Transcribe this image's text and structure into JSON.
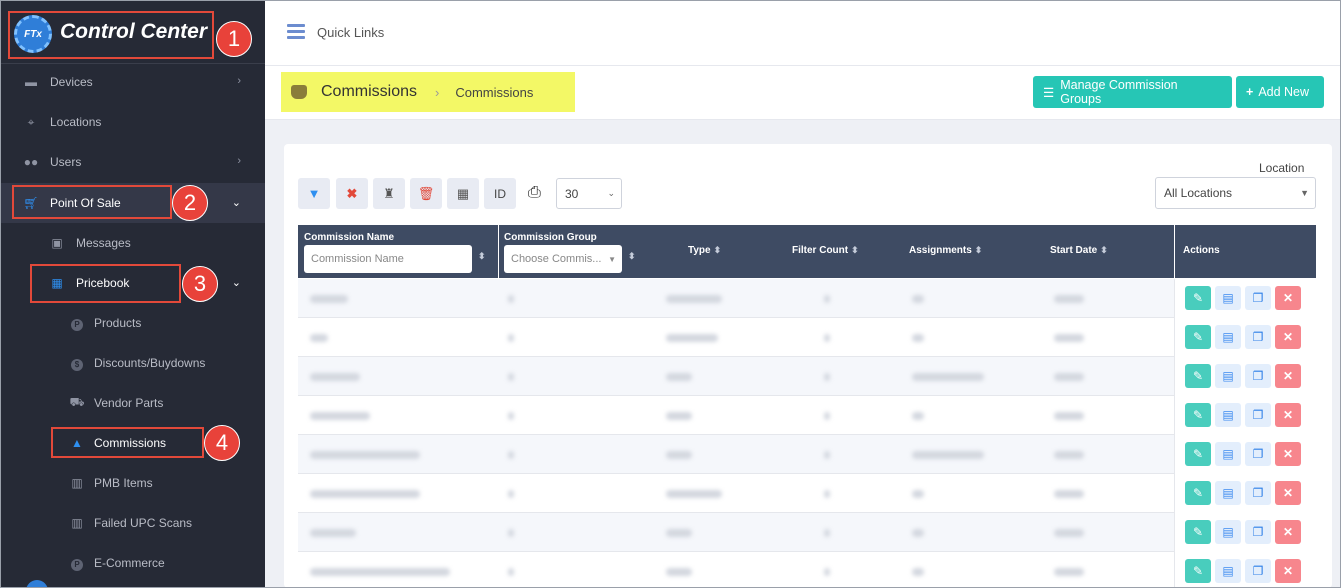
{
  "brand": {
    "logo_text": "FTx",
    "title": "Control Center"
  },
  "sidebar": {
    "items": [
      {
        "label": "Devices",
        "icon": "devices-icon"
      },
      {
        "label": "Locations",
        "icon": "map-pin-icon"
      },
      {
        "label": "Users",
        "icon": "users-icon"
      },
      {
        "label": "Point Of Sale",
        "icon": "cart-icon"
      },
      {
        "label": "Messages",
        "icon": "messages-icon"
      },
      {
        "label": "Pricebook",
        "icon": "calculator-icon"
      },
      {
        "label": "Products",
        "icon": "product-icon"
      },
      {
        "label": "Discounts/Buydowns",
        "icon": "discount-icon"
      },
      {
        "label": "Vendor Parts",
        "icon": "vendor-icon"
      },
      {
        "label": "Commissions",
        "icon": "money-bag-icon"
      },
      {
        "label": "PMB Items",
        "icon": "pmb-icon"
      },
      {
        "label": "Failed UPC Scans",
        "icon": "barcode-icon"
      },
      {
        "label": "E-Commerce",
        "icon": "ecommerce-icon"
      }
    ]
  },
  "annotations": [
    "1",
    "2",
    "3",
    "4"
  ],
  "topbar": {
    "quick_links": "Quick Links"
  },
  "breadcrumb": {
    "title": "Commissions",
    "current": "Commissions"
  },
  "buttons": {
    "manage_groups": "Manage Commission Groups",
    "add_new": "Add New"
  },
  "toolbar": {
    "id_label": "ID",
    "page_size": "30"
  },
  "location": {
    "label": "Location",
    "value": "All Locations"
  },
  "table": {
    "headers": {
      "name": "Commission Name",
      "group": "Commission Group",
      "type": "Type",
      "filter_count": "Filter Count",
      "assignments": "Assignments",
      "start_date": "Start Date",
      "actions": "Actions"
    },
    "name_placeholder": "Commission Name",
    "group_placeholder": "Choose Commis...",
    "row_count": 8
  },
  "colors": {
    "sidebar_bg": "#262a36",
    "teal": "#26c6b5",
    "header_bg": "#3e4b63",
    "highlight": "#f3f866",
    "annotation_red": "#e8423a"
  }
}
